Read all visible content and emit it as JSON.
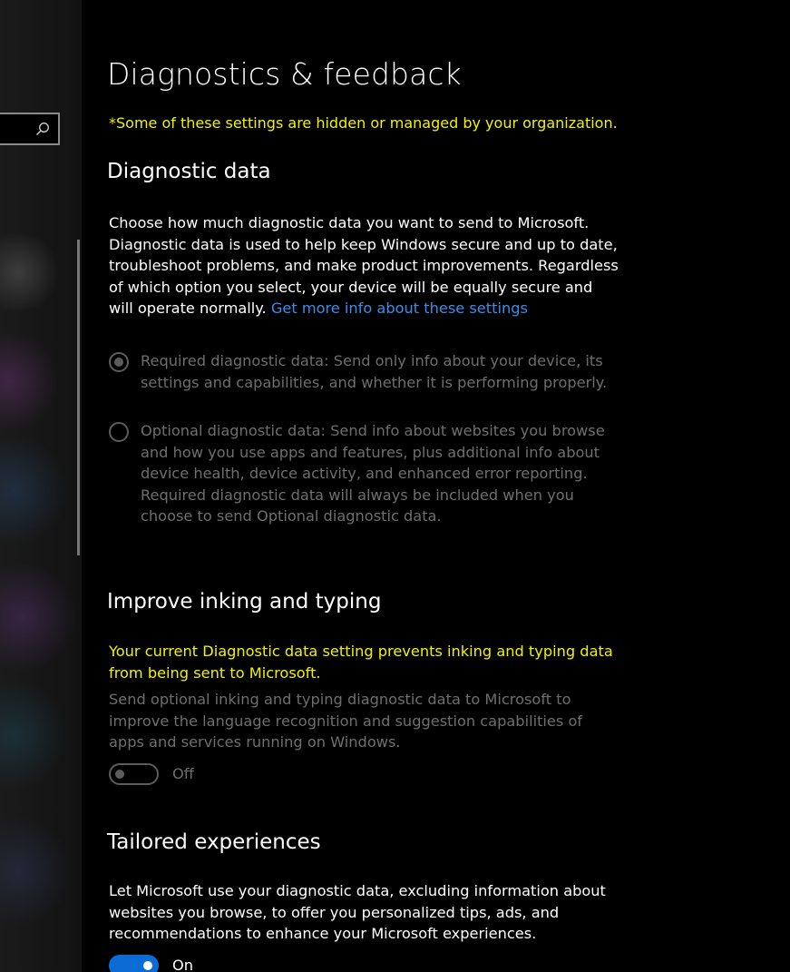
{
  "page": {
    "title": "Diagnostics & feedback",
    "org_notice": "*Some of these settings are hidden or managed by your organization."
  },
  "search": {
    "icon": "search-icon"
  },
  "diagnostic_data": {
    "title": "Diagnostic data",
    "description": "Choose how much diagnostic data you want to send to Microsoft. Diagnostic data is used to help keep Windows secure and up to date, troubleshoot problems, and make product improvements. Regardless of which option you select, your device will be equally secure and will operate normally.",
    "link": "Get more info about these settings",
    "options": [
      {
        "label": "Required diagnostic data: Send only info about your device, its settings and capabilities, and whether it is performing properly.",
        "selected": true,
        "disabled": true
      },
      {
        "label": "Optional diagnostic data: Send info about websites you browse and how you use apps and features, plus additional info about device health, device activity, and enhanced error reporting. Required diagnostic data will always be included when you choose to send Optional diagnostic data.",
        "selected": false,
        "disabled": true
      }
    ]
  },
  "inking": {
    "title": "Improve inking and typing",
    "warning": "Your current Diagnostic data setting prevents inking and typing data from being sent to Microsoft.",
    "description": "Send optional inking and typing diagnostic data to Microsoft to improve the language recognition and suggestion capabilities of apps and services running on Windows.",
    "toggle_state": "Off"
  },
  "tailored": {
    "title": "Tailored experiences",
    "description": "Let Microsoft use your diagnostic data, excluding information about websites you browse, to offer you personalized tips, ads, and recommendations to enhance your Microsoft experiences.",
    "toggle_state": "On"
  },
  "colors": {
    "warning": "#f2f200",
    "link": "#3b8eea",
    "accent": "#0a6cd4",
    "disabled": "#6e6e6e"
  }
}
